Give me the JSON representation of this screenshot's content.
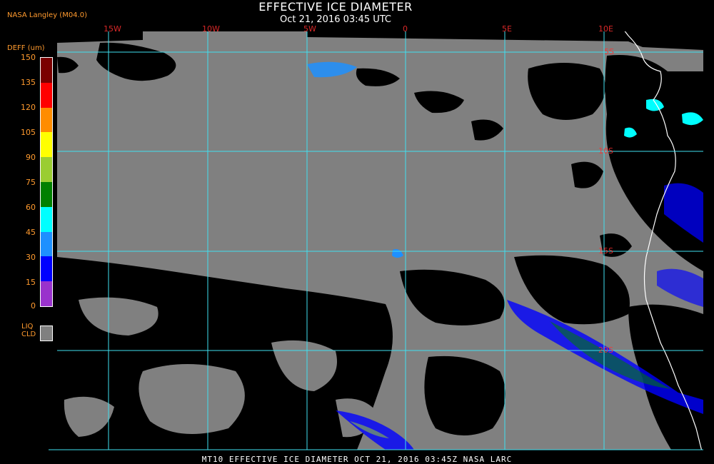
{
  "header": {
    "title": "EFFECTIVE ICE DIAMETER",
    "datetime": "Oct 21, 2016 03:45 UTC",
    "producer": "NASA Langley (M04.0)"
  },
  "legend": {
    "title": "DEFF (um)",
    "ticks": [
      "150",
      "135",
      "120",
      "105",
      "90",
      "75",
      "60",
      "45",
      "30",
      "15",
      "0"
    ],
    "colors": [
      "#7a0000",
      "#ff0000",
      "#ff8c00",
      "#ffff00",
      "#9acd32",
      "#008000",
      "#00ffff",
      "#1e90ff",
      "#0000ff",
      "#9932cc"
    ],
    "liquid_label_1": "LIQ",
    "liquid_label_2": "CLD",
    "liquid_color": "#808080"
  },
  "grid": {
    "lon_labels": [
      "15W",
      "10W",
      "5W",
      "0",
      "5E",
      "10E"
    ],
    "lat_labels": [
      "5S",
      "10S",
      "15S",
      "20S"
    ],
    "line_color": "#40e0f0"
  },
  "footer": {
    "text": "MT10  EFFECTIVE ICE DIAMETER  OCT 21, 2016 03:45Z  NASA LARC"
  },
  "colors": {
    "liquid_cloud": "#808080",
    "clear": "#000000",
    "coastline": "#ffffff",
    "label": "#ff9a2e"
  }
}
